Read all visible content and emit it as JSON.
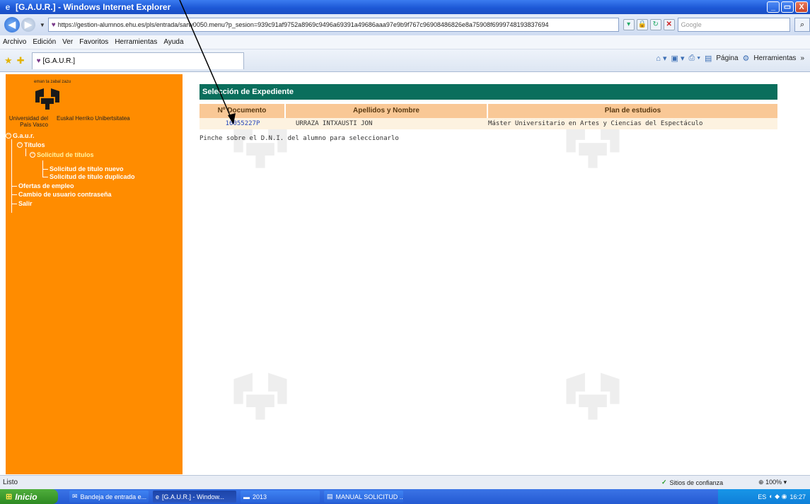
{
  "window": {
    "title": "[G.A.U.R.] - Windows Internet Explorer",
    "minimize": "_",
    "maximize": "▭",
    "close": "X"
  },
  "address_bar": {
    "url": "https://gestion-alumnos.ehu.es/pls/entrada/sarw0050.menu?p_sesion=939c91af9752a8969c9496a69391a49686aaa97e9b9f767c96908486826e8a75908f6999748193837694",
    "search_placeholder": "Google"
  },
  "menu": [
    "Archivo",
    "Edición",
    "Ver",
    "Favoritos",
    "Herramientas",
    "Ayuda"
  ],
  "tab": {
    "label": "[G.A.U.R.]"
  },
  "command_bar": {
    "page": "Página",
    "tools": "Herramientas"
  },
  "logo": {
    "tagline": "eman ta zabal zazu",
    "uni_es": "Universidad del País Vasco",
    "uni_eu": "Euskal Herriko Unibertsitatea"
  },
  "nav": {
    "root": "G.a.u.r.",
    "titulos": "Títulos",
    "solicitud_titulos": "Solicitud de títulos",
    "solicitud_nuevo": "Solicitud de título nuevo",
    "solicitud_duplicado": "Solicitud de título duplicado",
    "ofertas": "Ofertas de empleo",
    "cambio": "Cambio de usuario contraseña",
    "salir": "Salir"
  },
  "panel": {
    "title": "Selección de Expediente",
    "columns": [
      "Nº Documento",
      "Apellidos y Nombre",
      "Plan de estudios"
    ],
    "rows": [
      {
        "documento": "16055227P",
        "nombre": "URRAZA INTXAUSTI JON",
        "plan": "Máster Universitario en Artes y Ciencias del Espectáculo"
      }
    ],
    "hint": "Pinche sobre el D.N.I. del alumno para seleccionarlo"
  },
  "status": {
    "left": "Listo",
    "zone": "Sitios de confianza",
    "zoom": "100%"
  },
  "taskbar": {
    "start": "Inicio",
    "tasks": [
      "Bandeja de entrada e...",
      "[G.A.U.R.] - Window...",
      "2013",
      "MANUAL SOLICITUD ..."
    ],
    "lang": "ES",
    "clock": "16:27"
  },
  "colors": {
    "sidebar": "#ff8c00",
    "header": "#0a6e5c",
    "table_header": "#f9c896",
    "link": "#2244bb"
  }
}
